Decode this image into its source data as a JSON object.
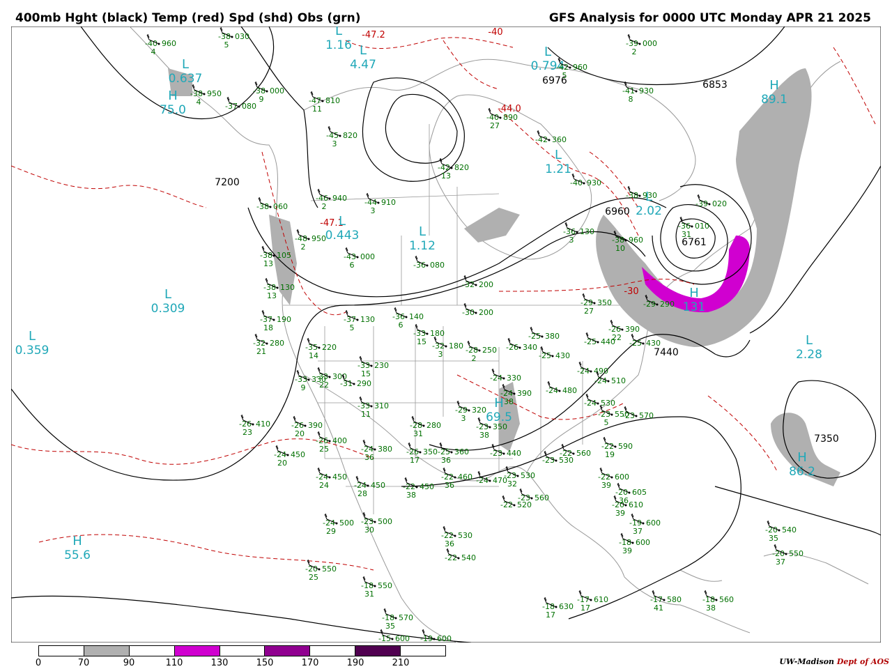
{
  "header": {
    "left_title": "400mb Hght (black) Temp (red) Spd (shd) Obs (grn)",
    "right_title": "GFS Analysis for 0000 UTC Monday  APR 21 2025"
  },
  "colors": {
    "height": "#000000",
    "temp": "#c00000",
    "obs": "#007000",
    "centers": "#20a8b8",
    "borders": "#999999",
    "speed_70": "#b0b0b0",
    "speed_110": "#d000d0",
    "speed_150": "#900090",
    "speed_190": "#500050"
  },
  "height_labels": [
    {
      "text": "7200"
    },
    {
      "text": "6976"
    },
    {
      "text": "6853"
    },
    {
      "text": "6960"
    },
    {
      "text": "6761"
    },
    {
      "text": "7440"
    },
    {
      "text": "7350"
    }
  ],
  "temp_labels": [
    {
      "text": "-47.2"
    },
    {
      "text": "-40"
    },
    {
      "text": "-44.0"
    },
    {
      "text": "-47.1"
    },
    {
      "text": "-30"
    }
  ],
  "centers": [
    {
      "type": "L",
      "value": "0.637"
    },
    {
      "type": "H",
      "value": "75.0"
    },
    {
      "type": "L",
      "value": "1.16"
    },
    {
      "type": "L",
      "value": "4.47"
    },
    {
      "type": "L",
      "value": "0.794"
    },
    {
      "type": "H",
      "value": "89.1"
    },
    {
      "type": "L",
      "value": "1.21"
    },
    {
      "type": "L",
      "value": "2.02"
    },
    {
      "type": "L",
      "value": "0.443"
    },
    {
      "type": "L",
      "value": "1.12"
    },
    {
      "type": "L",
      "value": "0.309"
    },
    {
      "type": "L",
      "value": "0.359"
    },
    {
      "type": "H",
      "value": "131"
    },
    {
      "type": "L",
      "value": "2.28"
    },
    {
      "type": "H",
      "value": "86.2"
    },
    {
      "type": "H",
      "value": "55.6"
    },
    {
      "type": "H",
      "value": "69.5"
    }
  ],
  "observations": [
    {
      "t": "-40",
      "h": "960",
      "d": "4"
    },
    {
      "t": "-38",
      "h": "030",
      "d": "5"
    },
    {
      "t": "-38",
      "h": "950",
      "d": "4"
    },
    {
      "t": "-37",
      "h": "080",
      "d": ""
    },
    {
      "t": "-38",
      "h": "000",
      "d": "9"
    },
    {
      "t": "-47",
      "h": "810",
      "d": "11"
    },
    {
      "t": "-45",
      "h": "820",
      "d": "3"
    },
    {
      "t": "-42",
      "h": "820",
      "d": "13"
    },
    {
      "t": "-40",
      "h": "890",
      "d": "27"
    },
    {
      "t": "-42",
      "h": "360",
      "d": ""
    },
    {
      "t": "-42",
      "h": "960",
      "d": "5"
    },
    {
      "t": "-39",
      "h": "000",
      "d": "2"
    },
    {
      "t": "-41",
      "h": "930",
      "d": "8"
    },
    {
      "t": "-40",
      "h": "930",
      "d": ""
    },
    {
      "t": "-38",
      "h": "930",
      "d": ""
    },
    {
      "t": "-39",
      "h": "020",
      "d": ""
    },
    {
      "t": "-38",
      "h": "960",
      "d": "10"
    },
    {
      "t": "-38",
      "h": "060",
      "d": ""
    },
    {
      "t": "-38",
      "h": "105",
      "d": "13"
    },
    {
      "t": "-38",
      "h": "130",
      "d": "13"
    },
    {
      "t": "-37",
      "h": "190",
      "d": "18"
    },
    {
      "t": "-32",
      "h": "280",
      "d": "21"
    },
    {
      "t": "-35",
      "h": "220",
      "d": "14"
    },
    {
      "t": "-46",
      "h": "940",
      "d": "2"
    },
    {
      "t": "-44",
      "h": "910",
      "d": "3"
    },
    {
      "t": "-48",
      "h": "950",
      "d": "2"
    },
    {
      "t": "-43",
      "h": "000",
      "d": "6"
    },
    {
      "t": "-37",
      "h": "130",
      "d": "5"
    },
    {
      "t": "-36",
      "h": "140",
      "d": "6"
    },
    {
      "t": "-36",
      "h": "080",
      "d": ""
    },
    {
      "t": "-32",
      "h": "200",
      "d": ""
    },
    {
      "t": "-30",
      "h": "200",
      "d": ""
    },
    {
      "t": "-33",
      "h": "180",
      "d": "15"
    },
    {
      "t": "-32",
      "h": "180",
      "d": "3"
    },
    {
      "t": "-28",
      "h": "250",
      "d": "2"
    },
    {
      "t": "-26",
      "h": "340",
      "d": ""
    },
    {
      "t": "-25",
      "h": "380",
      "d": ""
    },
    {
      "t": "-25",
      "h": "430",
      "d": ""
    },
    {
      "t": "-25",
      "h": "440",
      "d": ""
    },
    {
      "t": "-29",
      "h": "350",
      "d": "27"
    },
    {
      "t": "-26",
      "h": "390",
      "d": "22"
    },
    {
      "t": "-25",
      "h": "430",
      "d": ""
    },
    {
      "t": "-29",
      "h": "290",
      "d": ""
    },
    {
      "t": "-33",
      "h": "330",
      "d": "9"
    },
    {
      "t": "-33",
      "h": "300",
      "d": "22"
    },
    {
      "t": "-31",
      "h": "290",
      "d": ""
    },
    {
      "t": "-33",
      "h": "230",
      "d": "15"
    },
    {
      "t": "-33",
      "h": "310",
      "d": "11"
    },
    {
      "t": "-24",
      "h": "330",
      "d": ""
    },
    {
      "t": "-24",
      "h": "390",
      "d": "38"
    },
    {
      "t": "-24",
      "h": "480",
      "d": ""
    },
    {
      "t": "-24",
      "h": "490",
      "d": ""
    },
    {
      "t": "-24",
      "h": "510",
      "d": ""
    },
    {
      "t": "-26",
      "h": "410",
      "d": "23"
    },
    {
      "t": "-26",
      "h": "390",
      "d": "20"
    },
    {
      "t": "-26",
      "h": "400",
      "d": "25"
    },
    {
      "t": "-28",
      "h": "280",
      "d": "31"
    },
    {
      "t": "-29",
      "h": "320",
      "d": "3"
    },
    {
      "t": "-23",
      "h": "350",
      "d": "38"
    },
    {
      "t": "-24",
      "h": "530",
      "d": ""
    },
    {
      "t": "-23",
      "h": "550",
      "d": "5"
    },
    {
      "t": "-23",
      "h": "570",
      "d": ""
    },
    {
      "t": "-24",
      "h": "450",
      "d": "20"
    },
    {
      "t": "-24",
      "h": "380",
      "d": "36"
    },
    {
      "t": "-26",
      "h": "350",
      "d": "17"
    },
    {
      "t": "-25",
      "h": "360",
      "d": "36"
    },
    {
      "t": "-23",
      "h": "440",
      "d": ""
    },
    {
      "t": "-23",
      "h": "530",
      "d": ""
    },
    {
      "t": "-22",
      "h": "560",
      "d": ""
    },
    {
      "t": "-22",
      "h": "590",
      "d": "19"
    },
    {
      "t": "-24",
      "h": "450",
      "d": "24"
    },
    {
      "t": "-24",
      "h": "450",
      "d": "28"
    },
    {
      "t": "-22",
      "h": "450",
      "d": "38"
    },
    {
      "t": "-22",
      "h": "460",
      "d": "36"
    },
    {
      "t": "-24",
      "h": "470",
      "d": ""
    },
    {
      "t": "-23",
      "h": "530",
      "d": "32"
    },
    {
      "t": "-22",
      "h": "600",
      "d": "39"
    },
    {
      "t": "-22",
      "h": "520",
      "d": ""
    },
    {
      "t": "-23",
      "h": "560",
      "d": ""
    },
    {
      "t": "-20",
      "h": "610",
      "d": "39"
    },
    {
      "t": "-20",
      "h": "605",
      "d": "36"
    },
    {
      "t": "-19",
      "h": "600",
      "d": "37"
    },
    {
      "t": "-18",
      "h": "600",
      "d": "39"
    },
    {
      "t": "-24",
      "h": "500",
      "d": "29"
    },
    {
      "t": "-23",
      "h": "500",
      "d": "30"
    },
    {
      "t": "-22",
      "h": "530",
      "d": "36"
    },
    {
      "t": "-22",
      "h": "540",
      "d": ""
    },
    {
      "t": "-20",
      "h": "550",
      "d": "25"
    },
    {
      "t": "-18",
      "h": "550",
      "d": "31"
    },
    {
      "t": "-18",
      "h": "570",
      "d": "35"
    },
    {
      "t": "-15",
      "h": "600",
      "d": ""
    },
    {
      "t": "-19",
      "h": "600",
      "d": ""
    },
    {
      "t": "-18",
      "h": "630",
      "d": "17"
    },
    {
      "t": "-17",
      "h": "610",
      "d": "17"
    },
    {
      "t": "-17",
      "h": "580",
      "d": "41"
    },
    {
      "t": "-18",
      "h": "560",
      "d": "38"
    },
    {
      "t": "-20",
      "h": "540",
      "d": "35"
    },
    {
      "t": "-20",
      "h": "550",
      "d": "37"
    },
    {
      "t": "-36",
      "h": "010",
      "d": "31"
    },
    {
      "t": "-36",
      "h": "130",
      "d": "3"
    }
  ],
  "legend": {
    "labels": [
      "0",
      "70",
      "90",
      "110",
      "130",
      "150",
      "170",
      "190",
      "210"
    ],
    "cells": [
      "#ffffff",
      "#b0b0b0",
      "#ffffff",
      "#d000d0",
      "#ffffff",
      "#900090",
      "#ffffff",
      "#500050",
      "#ffffff"
    ]
  },
  "credit": {
    "institution": "UW-Madison",
    "department": "Dept of AOS"
  }
}
